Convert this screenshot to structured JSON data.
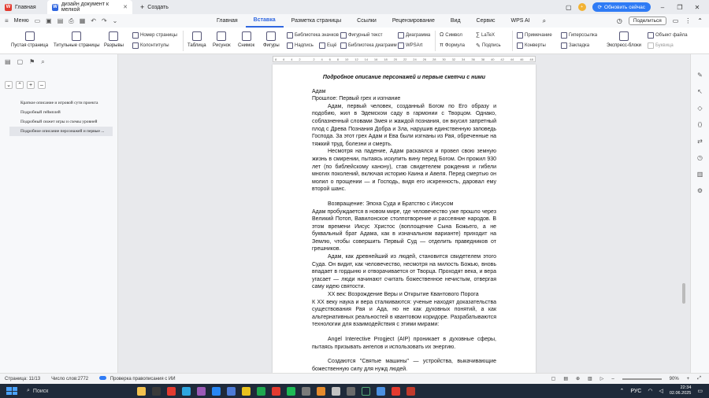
{
  "titlebar": {
    "home_tab": "Главная",
    "doc_tab": "дизайн документ  к мелкой",
    "new_tab": "Создать",
    "avatar": "+",
    "update_button": "Обновить сейчас"
  },
  "menubar": {
    "menu": "Меню",
    "tabs": [
      "Главная",
      "Вставка",
      "Разметка страницы",
      "Ссылки",
      "Рецензирование",
      "Вид",
      "Сервис",
      "WPS AI"
    ],
    "active_tab": "Вставка",
    "share": "Поделиться"
  },
  "ribbon": {
    "blank_page": "Пустая страница",
    "title_pages": "Титульные страницы",
    "breaks": "Разрывы",
    "page_number": "Номер страницы",
    "header_footer": "Колонтитулы",
    "table": "Таблица",
    "picture": "Рисунок",
    "screenshot": "Снимок",
    "shapes": "Фигуры",
    "icon_library": "Библиотека значков",
    "more": "Ещё",
    "shaped_text": "Фигурный  текст",
    "chart_library": "Библиотека диаграмм",
    "diagram": "Диаграмма",
    "wpsart": "WPSArt",
    "caption": "Надпись",
    "symbol": "Символ",
    "latex": "LaTeX",
    "formula": "Формула",
    "signature": "Подпись",
    "comment": "Примечание",
    "envelopes": "Конверты",
    "hyperlink": "Гиперссылка",
    "bookmark": "Закладка",
    "express_blocks": "Экспресс-блоки",
    "object_file": "Объект файла",
    "dropcap": "Буквица"
  },
  "navigation": {
    "items": [
      "Краткое описание и игровой сути проекта",
      "Подробный геймплей",
      "Подробный сюжет игры и схемы уровней",
      "Подробное описание персонажей и первые ..."
    ],
    "active_index": 3
  },
  "ruler": [
    "8",
    "6",
    "4",
    "2",
    "",
    "2",
    "4",
    "6",
    "8",
    "10",
    "12",
    "14",
    "16",
    "18",
    "20",
    "22",
    "24",
    "26",
    "28",
    "30",
    "32",
    "34",
    "36",
    "38",
    "40",
    "42",
    "44",
    "46",
    "48"
  ],
  "document": {
    "heading": "Подробное описание персонажей и первые скетчи с ними",
    "name_adam": "Адам",
    "sub1": "Прошлое: Первый грех и изгнание",
    "p1": "Адам, первый человек, созданный Богом по Его образу и подобию, жил в Эдемском саду в гармонии с Творцом. Однако, соблазненный словами Змея и жаждой познания, он вкусил запретный плод с Древа Познания Добра и Зла, нарушив единственную заповедь Господа. За этот грех Адам и Ева были изгнаны из Рая, обреченные на тяжкий труд, болезни и смерть.",
    "p2": "Несмотря на падение, Адам раскаялся и провел свою земную жизнь в смирении, пытаясь искупить вину перед Богом. Он прожил 930 лет (по библейскому канону), став свидетелем рождения и гибели многих поколений, включая историю Каина и Авеля. Перед смертью он молил о прощении — и Господь, видя его искренность, даровал ему второй шанс.",
    "sub2": "Возвращение: Эпоха Суда и Братство с Иисусом",
    "p3": "Адам пробуждается в новом мире, где человечество уже прошло через Великий Потоп, Вавилонское столпотворение и рассеяние народов. В этом времени Иисус Христос (воплощение Сына Божьего, а не буквальный брат Адама, как в изначальном варианте) приходит на Землю, чтобы совершить Первый Суд — отделить праведников от грешников.",
    "p4": "Адам, как древнейший из людей, становится свидетелем этого Суда. Он видит, как человечество, несмотря на милость Божью, вновь впадает в гордыню и отворачивается от Творца. Проходят века, и вера угасает — люди начинают считать божественное нечистым, отвергая саму идею святости.",
    "sub3": "XX век: Возрождение Веры и Открытие Квантового Порога",
    "p5": "К XX веку наука и вера сталкиваются: ученые находят доказательства существования Рая и Ада, но не как духовных понятий, а как альтернативных реальностей в квантовом коридоре. Разрабатываются технологии для взаимодействия с этими мирами:",
    "p6": "Angel Interective Progject (AIP) проникает в духовные сферы, пытаясь призывать ангелов и использовать их энергию.",
    "p7": "Создаются \"Святые машины\" — устройства, выкачивающие божественную силу для нужд людей."
  },
  "statusbar": {
    "page": "Страница: 11/13",
    "words": "Число слов:2772",
    "spell": "Проверка правописания с ИИ",
    "zoom": "90%"
  },
  "taskbar": {
    "search": "Поиск",
    "lang": "РУС",
    "time": "22:34",
    "date": "02.06.2025"
  },
  "colors": {
    "accent": "#2f66e0",
    "update_button": "#2f7bf5",
    "taskbar": "#1f2a3a",
    "spell_underline": "#dd4444"
  }
}
